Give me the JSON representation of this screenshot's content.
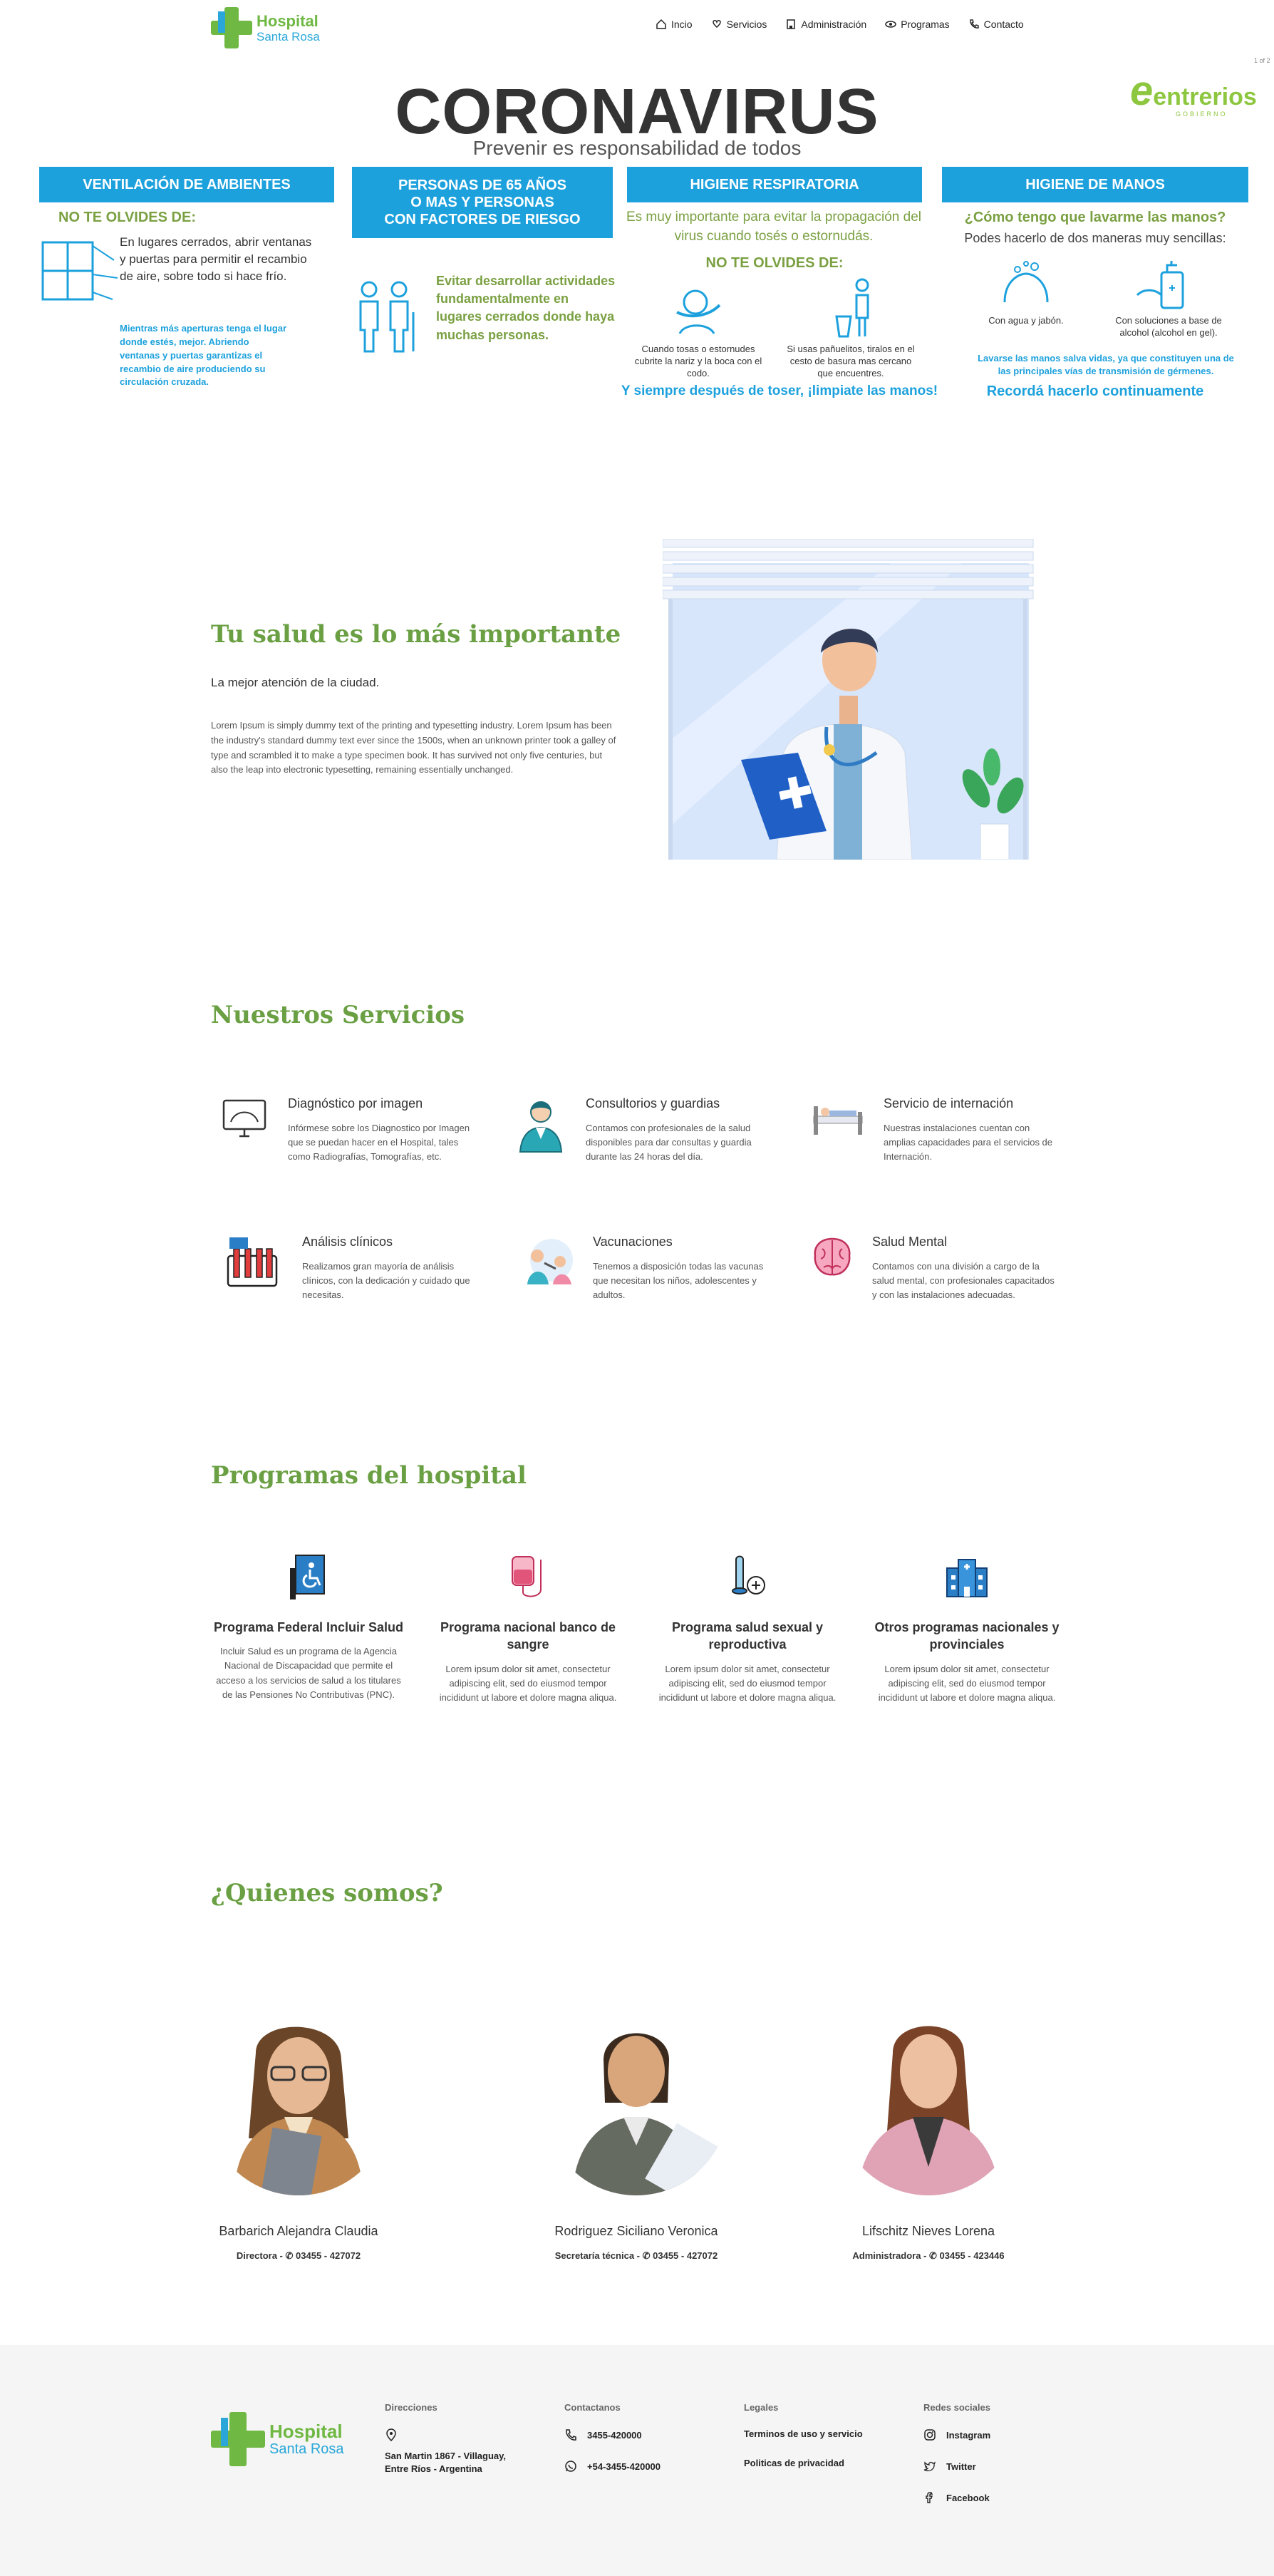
{
  "nav": {
    "logo_line1": "Hospital",
    "logo_line2": "Santa Rosa",
    "items": [
      {
        "label": "Incio",
        "icon": "home-icon"
      },
      {
        "label": "Servicios",
        "icon": "heart-hand-icon"
      },
      {
        "label": "Administración",
        "icon": "building-icon"
      },
      {
        "label": "Programas",
        "icon": "eye-icon"
      },
      {
        "label": "Contacto",
        "icon": "phone-icon"
      }
    ]
  },
  "banner": {
    "title": "CORONAVIRUS",
    "subtitle": "Prevenir es responsabilidad de todos",
    "logo_e": "e",
    "logo_text": "entrerios",
    "logo_sub": "GOBIERNO",
    "page": "1 of 2",
    "col1": {
      "heading": "VENTILACIÓN DE AMBIENTES",
      "reminder": "NO TE OLVIDES DE:",
      "text": "En lugares cerrados, abrir ventanas y puertas para permitir el recambio de aire, sobre todo si hace frío.",
      "note": "Mientras más aperturas tenga el lugar donde estés, mejor. Abriendo ventanas y puertas garantizas el recambio de aire produciendo su circulación cruzada."
    },
    "col2": {
      "heading_l1": "PERSONAS DE 65 AÑOS",
      "heading_l2": "O MAS Y PERSONAS",
      "heading_l3": "CON FACTORES DE RIESGO",
      "text": "Evitar desarrollar actividades fundamentalmente en lugares cerrados donde haya muchas personas."
    },
    "col3": {
      "heading": "HIGIENE RESPIRATORIA",
      "intro": "Es muy importante para evitar la propagación del virus cuando tosés o estornudás.",
      "reminder": "NO TE OLVIDES DE:",
      "tip1": "Cuando tosas o estornudes cubrite la nariz y la boca con el codo.",
      "tip2": "Si usas pañuelitos, tiralos en el cesto de basura mas cercano que encuentres.",
      "footer": "Y siempre después de toser, ¡limpiate las manos!"
    },
    "col4": {
      "heading": "HIGIENE DE MANOS",
      "question": "¿Cómo tengo que lavarme las manos?",
      "intro": "Podes hacerlo de dos maneras muy sencillas:",
      "tip1": "Con agua y jabón.",
      "tip2": "Con soluciones a base de alcohol (alcohol en gel).",
      "note": "Lavarse las manos salva vidas, ya que constituyen una de las principales vías de transmisión de gérmenes.",
      "footer": "Recordá hacerlo continuamente"
    }
  },
  "hero": {
    "title": "Tu salud es lo más importante",
    "subtitle": "La mejor atención de la ciudad.",
    "body": "Lorem Ipsum is simply dummy text of the printing and typesetting industry. Lorem Ipsum has been the industry's standard dummy text ever since the 1500s, when an unknown printer took a galley of type and scrambled it to make a type specimen book. It has survived not only five centuries, but also the leap into electronic typesetting, remaining essentially unchanged."
  },
  "services": {
    "title": "Nuestros Servicios",
    "items": [
      {
        "name": "Diagnóstico por imagen",
        "desc": "Infórmese sobre los Diagnostico por Imagen que se puedan hacer en el Hospital, tales como Radiografías, Tomografías, etc."
      },
      {
        "name": "Consultorios y guardias",
        "desc": "Contamos con profesionales de la salud disponibles para dar consultas y guardia durante las 24 horas del día."
      },
      {
        "name": "Servicio de internación",
        "desc": "Nuestras instalaciones cuentan con amplias capacidades para el servicios de Internación."
      },
      {
        "name": "Análisis clínicos",
        "desc": "Realizamos gran mayoría de análisis clínicos, con la dedicación y cuidado que necesitas."
      },
      {
        "name": "Vacunaciones",
        "desc": "Tenemos a disposición todas las vacunas que necesitan los niños, adolescentes y adultos."
      },
      {
        "name": "Salud Mental",
        "desc": "Contamos con una división a cargo de la salud mental, con profesionales capacitados y con las instalaciones adecuadas."
      }
    ]
  },
  "programs": {
    "title": "Programas del hospital",
    "items": [
      {
        "name": "Programa Federal Incluir Salud",
        "desc": "Incluir Salud es un programa de la Agencia Nacional de Discapacidad que permite el acceso a los servicios de salud a los titulares de las Pensiones No Contributivas (PNC)."
      },
      {
        "name": "Programa nacional banco de sangre",
        "desc": "Lorem ipsum dolor sit amet, consectetur adipiscing elit, sed do eiusmod tempor incididunt ut labore et dolore magna aliqua."
      },
      {
        "name": "Programa salud sexual y reproductiva",
        "desc": "Lorem ipsum dolor sit amet, consectetur adipiscing elit, sed do eiusmod tempor incididunt ut labore et dolore magna aliqua."
      },
      {
        "name": "Otros programas nacionales y provinciales",
        "desc": "Lorem ipsum dolor sit amet, consectetur adipiscing elit, sed do eiusmod tempor incididunt ut labore et dolore magna aliqua."
      }
    ]
  },
  "team": {
    "title": "¿Quienes somos?",
    "members": [
      {
        "name": "Barbarich Alejandra Claudia",
        "role": "Directora",
        "phone": "03455 - 427072"
      },
      {
        "name": "Rodriguez Siciliano Veronica",
        "role": "Secretaría técnica",
        "phone": "03455 - 427072"
      },
      {
        "name": "Lifschitz Nieves Lorena",
        "role": "Administradora",
        "phone": "03455 - 423446"
      }
    ]
  },
  "footer": {
    "logo_line1": "Hospital",
    "logo_line2": "Santa Rosa",
    "addresses_title": "Direcciones",
    "address": "San Martin 1867 - Villaguay, Entre Ríos - Argentina",
    "contact_title": "Contactanos",
    "phone": "3455-420000",
    "whatsapp": "+54-3455-420000",
    "legal_title": "Legales",
    "terms": "Terminos de uso y servicio",
    "privacy": "Politicas de privacidad",
    "social_title": "Redes sociales",
    "instagram": "Instagram",
    "twitter": "Twitter",
    "facebook": "Facebook"
  },
  "colors": {
    "green": "#6aa043",
    "blue": "#1da1dd",
    "footer_bg": "#f5f5f5"
  }
}
